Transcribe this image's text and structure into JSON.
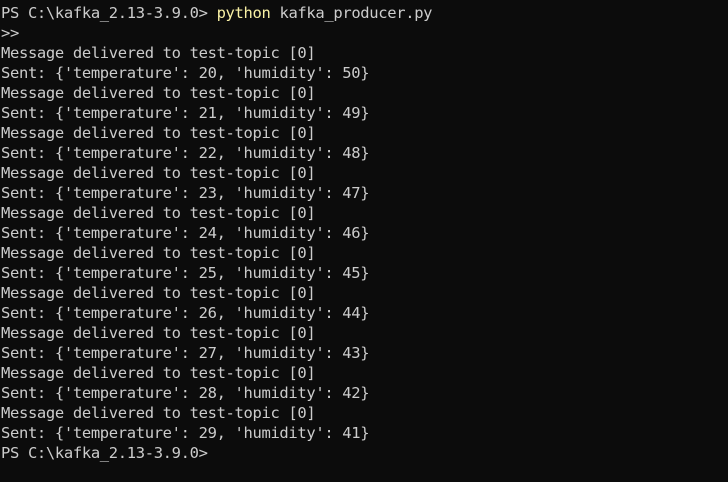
{
  "terminal": {
    "command_line": {
      "prompt": "PS C:\\kafka_2.13-3.9.0> ",
      "command": "python",
      "args": " kafka_producer.py"
    },
    "continuation": ">>",
    "output": [
      "Message delivered to test-topic [0]",
      "Sent: {'temperature': 20, 'humidity': 50}",
      "Message delivered to test-topic [0]",
      "Sent: {'temperature': 21, 'humidity': 49}",
      "Message delivered to test-topic [0]",
      "Sent: {'temperature': 22, 'humidity': 48}",
      "Message delivered to test-topic [0]",
      "Sent: {'temperature': 23, 'humidity': 47}",
      "Message delivered to test-topic [0]",
      "Sent: {'temperature': 24, 'humidity': 46}",
      "Message delivered to test-topic [0]",
      "Sent: {'temperature': 25, 'humidity': 45}",
      "Message delivered to test-topic [0]",
      "Sent: {'temperature': 26, 'humidity': 44}",
      "Message delivered to test-topic [0]",
      "Sent: {'temperature': 27, 'humidity': 43}",
      "Message delivered to test-topic [0]",
      "Sent: {'temperature': 28, 'humidity': 42}",
      "Message delivered to test-topic [0]",
      "Sent: {'temperature': 29, 'humidity': 41}"
    ],
    "final_prompt": "PS C:\\kafka_2.13-3.9.0>"
  },
  "colors": {
    "background": "#0c0c0c",
    "text": "#cccccc",
    "command": "#f9f1a5"
  }
}
